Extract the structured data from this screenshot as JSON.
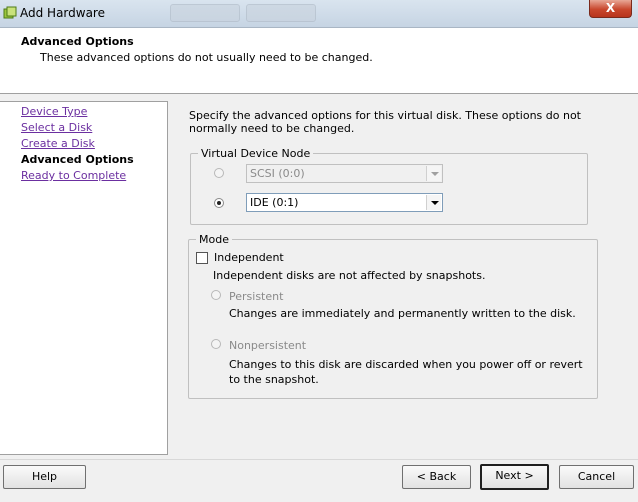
{
  "window": {
    "title": "Add Hardware",
    "close_label": "X"
  },
  "header": {
    "title": "Advanced Options",
    "subtitle": "These advanced options do not usually need to be changed."
  },
  "nav": {
    "items": [
      {
        "label": "Device Type",
        "state": "link"
      },
      {
        "label": "Select a Disk",
        "state": "link"
      },
      {
        "label": "Create a Disk",
        "state": "link"
      },
      {
        "label": "Advanced Options",
        "state": "current"
      },
      {
        "label": "Ready to Complete",
        "state": "link"
      }
    ]
  },
  "main": {
    "intro": "Specify the advanced options for this virtual disk. These options do not normally need to be changed.",
    "vdn": {
      "legend": "Virtual Device Node",
      "scsi": {
        "value": "SCSI (0:0)",
        "selected": false,
        "enabled": false
      },
      "ide": {
        "value": "IDE (0:1)",
        "selected": true,
        "enabled": true
      }
    },
    "mode": {
      "legend": "Mode",
      "independent": {
        "label": "Independent",
        "checked": false,
        "desc": "Independent disks are not affected by snapshots."
      },
      "persistent": {
        "label": "Persistent",
        "desc": "Changes are immediately and permanently written to the disk."
      },
      "nonpersistent": {
        "label": "Nonpersistent",
        "desc": "Changes to this disk are discarded when you power off or revert to the snapshot."
      }
    }
  },
  "buttons": {
    "help": "Help",
    "back": "< Back",
    "next": "Next >",
    "cancel": "Cancel"
  },
  "colors": {
    "link": "#6b2fa0",
    "header_bg": "#ffffff",
    "dialog_bg": "#f0f0f0"
  }
}
